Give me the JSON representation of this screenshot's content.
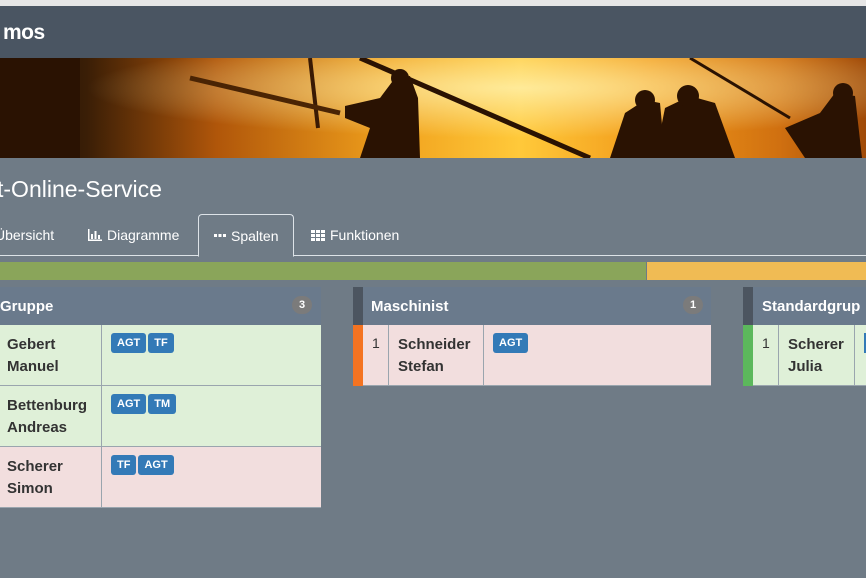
{
  "app": {
    "logo": "mos",
    "title": "t-Online-Service"
  },
  "tabs": [
    {
      "label": "Übersicht",
      "active": false
    },
    {
      "label": "Diagramme",
      "active": false,
      "icon": "bar-chart-icon"
    },
    {
      "label": "Spalten",
      "active": true,
      "icon": "ellipsis-icon"
    },
    {
      "label": "Funktionen",
      "active": false,
      "icon": "grid-icon"
    }
  ],
  "progress": {
    "green_fraction": 0.747,
    "orange_fraction": 0.253,
    "green_color": "#8aa55a",
    "orange_color": "#f0bb54"
  },
  "columns": [
    {
      "title": "Gruppe",
      "count": "3",
      "rows": [
        {
          "first": "Gebert",
          "last": "Manuel",
          "status": "green",
          "tags": [
            "AGT",
            "TF"
          ]
        },
        {
          "first": "Bettenburg",
          "last": "Andreas",
          "status": "green",
          "tags": [
            "AGT",
            "TM"
          ]
        },
        {
          "first": "Scherer",
          "last": "Simon",
          "status": "red",
          "tags": [
            "TF",
            "AGT"
          ]
        }
      ]
    },
    {
      "title": "Maschinist",
      "count": "1",
      "rows": [
        {
          "num": "1",
          "first": "Schneider",
          "last": "Stefan",
          "status": "red",
          "accent": "#f47321",
          "tags": [
            "AGT"
          ]
        }
      ]
    },
    {
      "title": "Standardgrup",
      "rows": [
        {
          "num": "1",
          "first": "Scherer",
          "last": "Julia",
          "status": "green",
          "accent": "#5cb85c",
          "tags": []
        }
      ]
    }
  ]
}
